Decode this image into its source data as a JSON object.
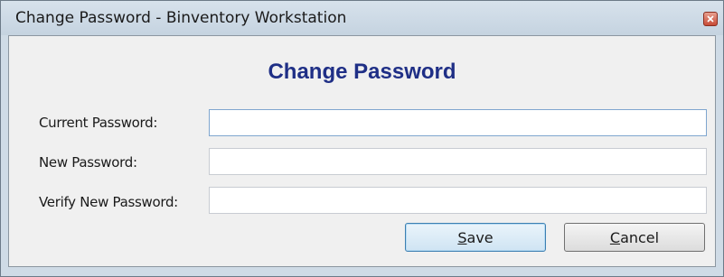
{
  "window": {
    "title": "Change Password - Binventory Workstation",
    "close_icon": "close-x-icon"
  },
  "form": {
    "heading": "Change Password",
    "fields": [
      {
        "label": "Current Password:",
        "value": "",
        "focused": true
      },
      {
        "label": "New Password:",
        "value": ""
      },
      {
        "label": "Verify New Password:",
        "value": ""
      }
    ]
  },
  "buttons": {
    "save_access_key": "S",
    "save_rest": "ave",
    "cancel_access_key": "C",
    "cancel_rest": "ancel"
  },
  "colors": {
    "heading": "#1f2f86",
    "titlebar": "#cfdbe6",
    "client_bg": "#f0f0f0",
    "close_button": "#c74b36"
  }
}
